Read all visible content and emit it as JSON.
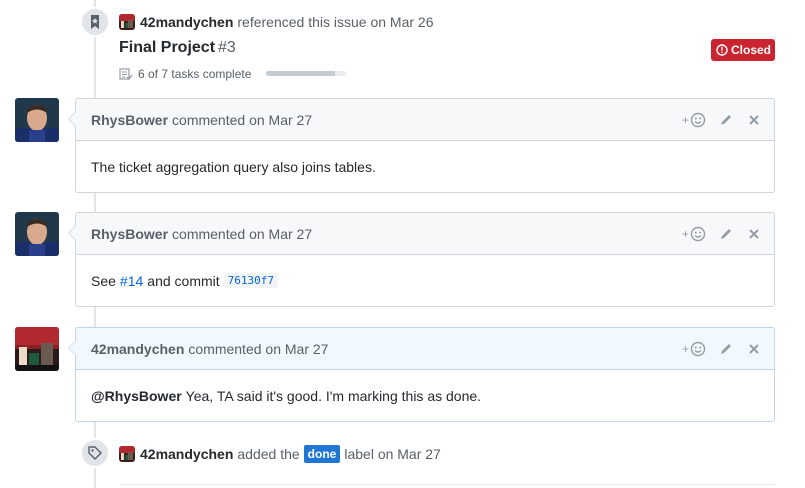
{
  "events": {
    "reference": {
      "actor": "42mandychen",
      "action": "referenced this issue on Mar 26",
      "title": "Final Project",
      "number": "#3",
      "status": "Closed",
      "tasks": "6 of 7 tasks complete",
      "task_progress": 0.857,
      "icon": "bookmark-icon"
    },
    "label": {
      "actor": "42mandychen",
      "action": "added the",
      "label": "done",
      "date": "label on Mar 27",
      "icon": "tag-icon"
    }
  },
  "comments": [
    {
      "author": "RhysBower",
      "meta": "commented on Mar 27",
      "body": "The ticket aggregation query also joins tables."
    },
    {
      "author": "RhysBower",
      "meta": "commented on Mar 27",
      "body_prefix": "See",
      "issue_link": "#14",
      "body_mid": "and commit",
      "commit": "76130f7"
    },
    {
      "author": "42mandychen",
      "meta": "commented on Mar 27",
      "mention": "@RhysBower",
      "body": "Yea, TA said it's good. I'm marking this as done."
    }
  ],
  "actions": {
    "plus": "+"
  },
  "colors": {
    "closed": "#cb2431",
    "link": "#0366d6",
    "label_done": "#1f76d3",
    "header_bg": "#f6f8fa",
    "owner_header_bg": "#f1f8ff"
  }
}
